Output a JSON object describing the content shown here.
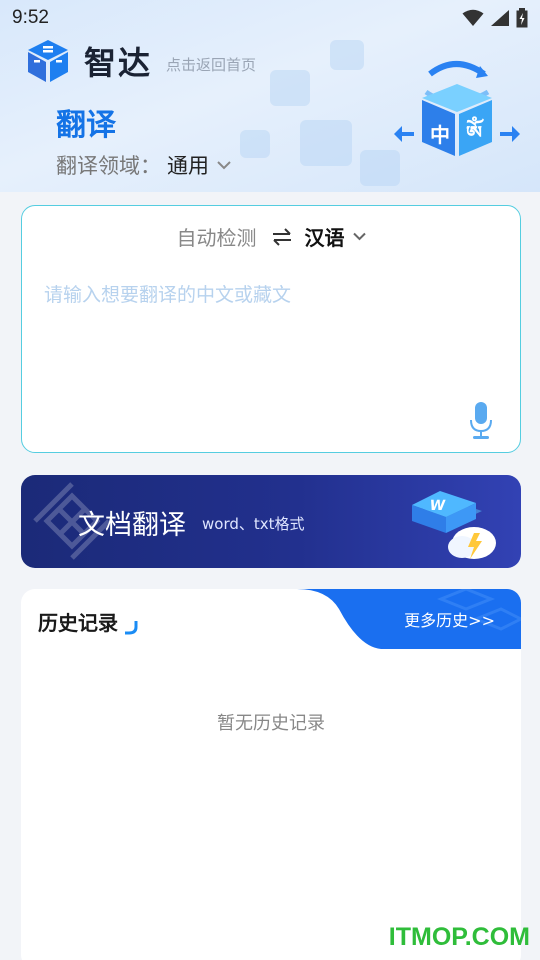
{
  "status_bar": {
    "time": "9:52"
  },
  "brand": {
    "name": "智达",
    "hint": "点击返回首页"
  },
  "page": {
    "title": "翻译"
  },
  "domain": {
    "label": "翻译领域：",
    "value": "通用"
  },
  "translator": {
    "source_lang": "自动检测",
    "target_lang": "汉语",
    "placeholder": "请输入想要翻译的中文或藏文",
    "input_value": ""
  },
  "doc_translate": {
    "title": "文档翻译",
    "subtitle": "word、txt格式"
  },
  "history": {
    "title": "历史记录",
    "more_link": "更多历史>>",
    "empty_text": "暂无历史记录"
  },
  "watermark": "ITMOP.COM",
  "hero_cube_text": [
    "中",
    "ༀ"
  ],
  "icons": {
    "wifi": "wifi-icon",
    "signal": "signal-icon",
    "battery": "battery-icon",
    "swap": "swap-arrows-icon",
    "chevron": "chevron-down-icon",
    "mic": "microphone-icon"
  },
  "colors": {
    "accent": "#1473e6",
    "input_border": "#55cde0",
    "placeholder": "#b7d2ee",
    "banner": "#22308e",
    "watermark": "#2fbd3a"
  }
}
